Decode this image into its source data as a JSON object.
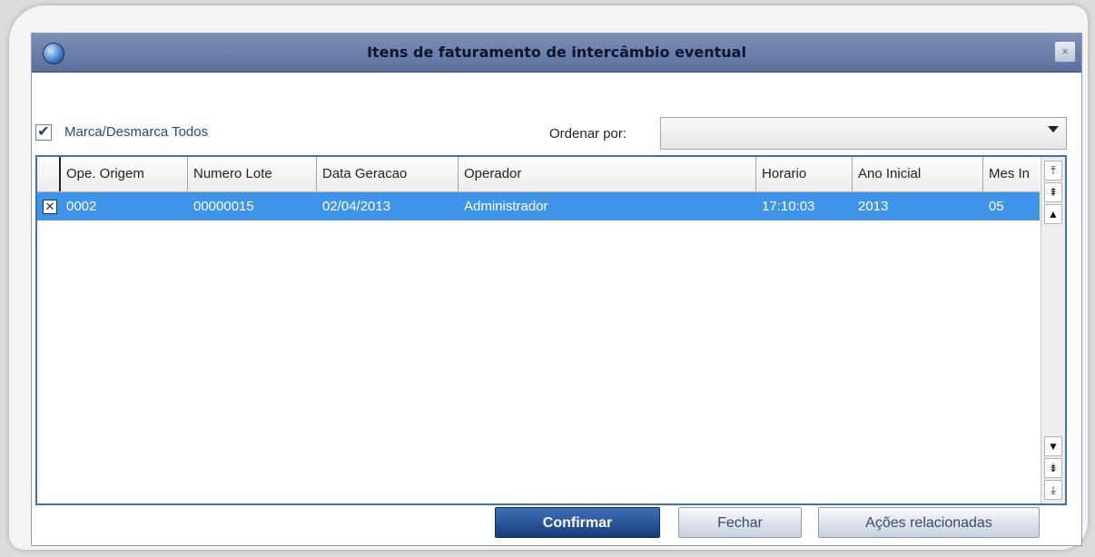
{
  "window": {
    "title": "Itens de faturamento de intercâmbio eventual",
    "close_label": "×"
  },
  "filters": {
    "check_all_label": "Marca/Desmarca Todos",
    "check_all_mark": "✔",
    "sort_label": "Ordenar por:",
    "sort_value": ""
  },
  "grid": {
    "columns": [
      "Ope. Origem",
      "Numero Lote",
      "Data Geracao",
      "Operador",
      "Horario",
      "Ano Inicial",
      "Mes In"
    ],
    "rows": [
      {
        "selected": true,
        "mark": "✕",
        "cells": [
          "0002",
          "00000015",
          "02/04/2013",
          "Administrador",
          "17:10:03",
          "2013",
          "05"
        ]
      }
    ]
  },
  "scroll": {
    "top": "⤒",
    "page_up": "⇞",
    "up": "▲",
    "down": "▼",
    "page_down": "⇟",
    "bottom": "⤓"
  },
  "footer": {
    "confirm": "Confirmar",
    "close": "Fechar",
    "actions": "Ações relacionadas"
  },
  "colors": {
    "selected_row": "#3d94e8",
    "title_bar": "#6b7fa9",
    "primary_button": "#163d7c"
  }
}
